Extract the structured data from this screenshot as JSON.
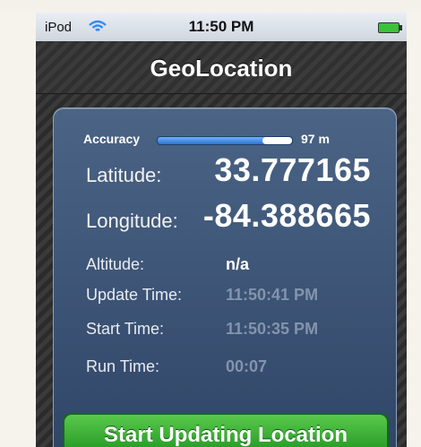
{
  "status_bar": {
    "carrier": "iPod",
    "time": "11:50 PM",
    "wifi_icon": "wifi-icon",
    "battery_icon": "battery-icon",
    "battery_color": "#39c23a"
  },
  "nav": {
    "title": "GeoLocation"
  },
  "accuracy": {
    "label": "Accuracy",
    "value": "97 m",
    "bar_colors": [
      "#6fb0ff",
      "#2e73d2"
    ]
  },
  "fields": {
    "latitude_label": "Latitude:",
    "latitude_value": "33.777165",
    "longitude_label": "Longitude:",
    "longitude_value": "-84.388665",
    "altitude_label": "Altitude:",
    "altitude_value": "n/a",
    "update_time_label": "Update Time:",
    "update_time_value": "11:50:41 PM",
    "start_time_label": "Start Time:",
    "start_time_value": "11:50:35 PM",
    "run_time_label": "Run Time:",
    "run_time_value": "00:07"
  },
  "button": {
    "label": "Start Updating Location",
    "color": "#1f9420"
  },
  "colors": {
    "card_bg": "#3e5577",
    "muted_value": "#8394ad"
  }
}
